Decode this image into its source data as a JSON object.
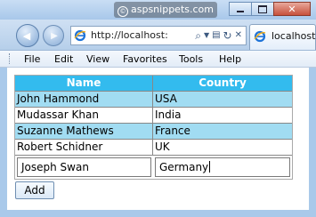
{
  "titlebar": {
    "watermark": "aspsnippets.com",
    "minimize_label": "–",
    "maximize_label": "□",
    "close_label": "✕"
  },
  "nav": {
    "back_glyph": "◀",
    "forward_glyph": "▶",
    "address": "http://localhost:",
    "tab_label": "localhost"
  },
  "menu": {
    "items": [
      "File",
      "Edit",
      "View",
      "Favorites",
      "Tools",
      "Help"
    ]
  },
  "table": {
    "headers": [
      "Name",
      "Country"
    ],
    "rows": [
      [
        "John Hammond",
        "USA"
      ],
      [
        "Mudassar Khan",
        "India"
      ],
      [
        "Suzanne Mathews",
        "France"
      ],
      [
        "Robert Schidner",
        "UK"
      ]
    ],
    "input_name": "Joseph Swan",
    "input_country": "Germany"
  },
  "buttons": {
    "add_label": "Add"
  },
  "colors": {
    "header_bg": "#33bbee",
    "alt_row_bg": "#a1dcf2",
    "chrome_bg": "#a9c9ea"
  }
}
